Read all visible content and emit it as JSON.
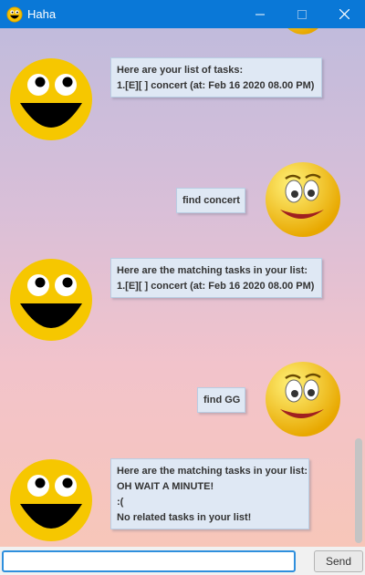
{
  "window": {
    "title": "Haha",
    "minimize_icon": "minimize-icon",
    "maximize_icon": "maximize-icon",
    "close_icon": "close-icon"
  },
  "messages": [
    {
      "sender": "bot",
      "lines": [
        "Here are your list of tasks:",
        "1.[E][ ] concert (at: Feb 16 2020 08.00 PM)"
      ]
    },
    {
      "sender": "user",
      "lines": [
        "find concert"
      ]
    },
    {
      "sender": "bot",
      "lines": [
        "Here are the matching tasks in your list:",
        "1.[E][ ] concert (at: Feb 16 2020 08.00 PM)"
      ]
    },
    {
      "sender": "user",
      "lines": [
        "find GG"
      ]
    },
    {
      "sender": "bot",
      "lines": [
        "Here are the matching tasks in your list:",
        "OH WAIT A MINUTE!",
        ":(",
        "No related tasks in your list!"
      ]
    }
  ],
  "input": {
    "value": "",
    "placeholder": ""
  },
  "send_button": {
    "label": "Send"
  },
  "colors": {
    "titlebar": "#0a78d7",
    "bubble": "#dfe8f4",
    "input_border": "#2f8fdd"
  }
}
